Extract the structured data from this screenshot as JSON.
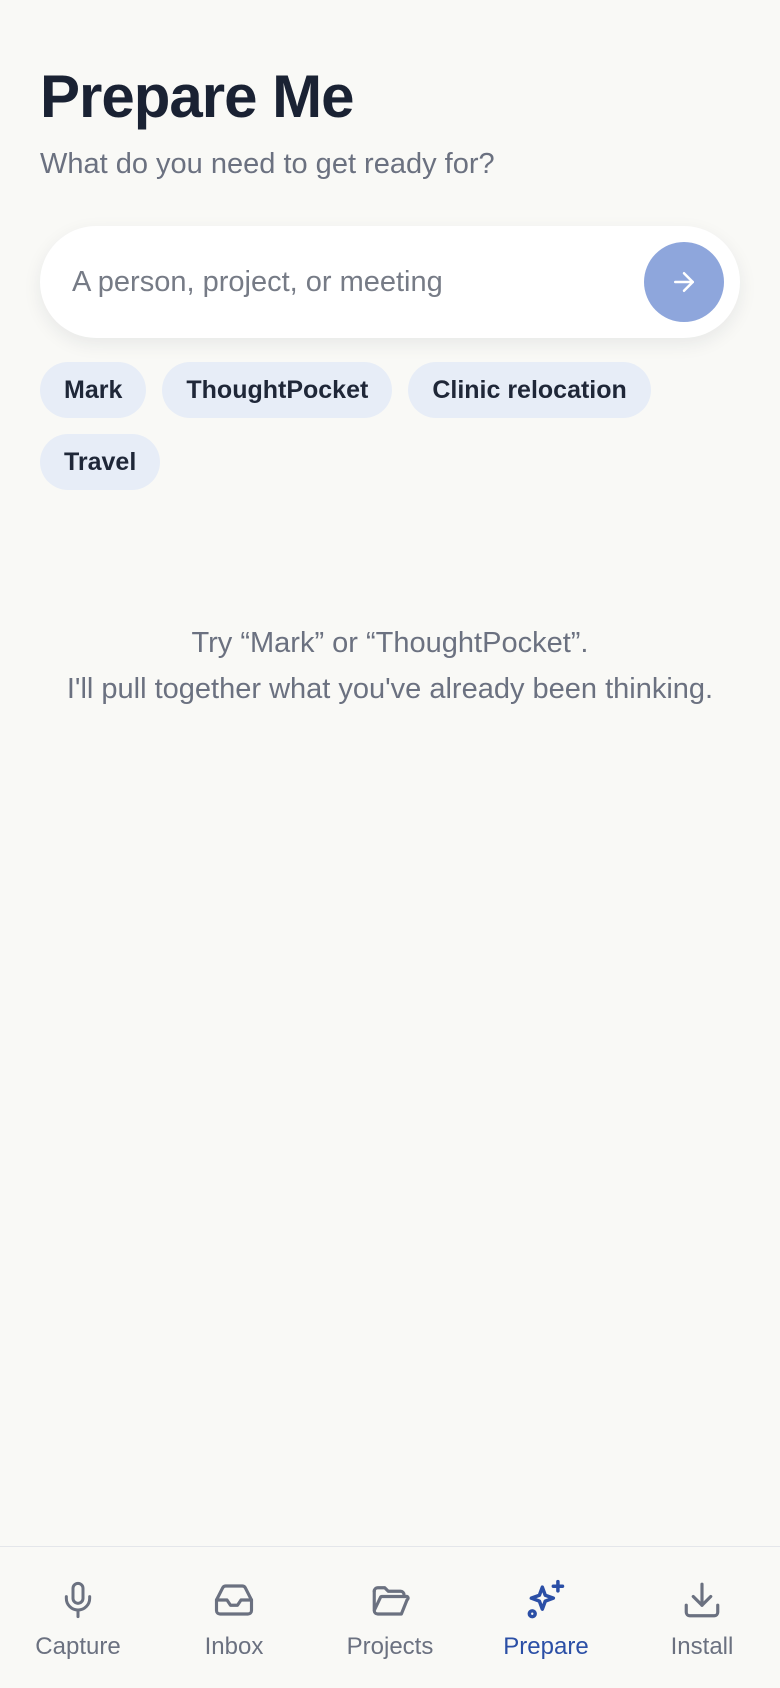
{
  "header": {
    "title": "Prepare Me",
    "subtitle": "What do you need to get ready for?"
  },
  "search": {
    "placeholder": "A person, project, or meeting",
    "value": "",
    "submit_icon": "arrow-right-icon"
  },
  "chips": [
    {
      "label": "Mark"
    },
    {
      "label": "ThoughtPocket"
    },
    {
      "label": "Clinic relocation"
    },
    {
      "label": "Travel"
    }
  ],
  "empty_state": {
    "line1": "Try “Mark” or “ThoughtPocket”.",
    "line2": "I'll pull together what you've already been thinking."
  },
  "tabs": [
    {
      "label": "Capture",
      "icon": "microphone-icon",
      "active": false
    },
    {
      "label": "Inbox",
      "icon": "inbox-icon",
      "active": false
    },
    {
      "label": "Projects",
      "icon": "folder-icon",
      "active": false
    },
    {
      "label": "Prepare",
      "icon": "sparkles-icon",
      "active": true
    },
    {
      "label": "Install",
      "icon": "download-icon",
      "active": false
    }
  ],
  "colors": {
    "background": "#f9f9f6",
    "accent": "#2b4fa6",
    "submit_button": "#8ea6dc",
    "chip_bg": "#e7edf7"
  }
}
